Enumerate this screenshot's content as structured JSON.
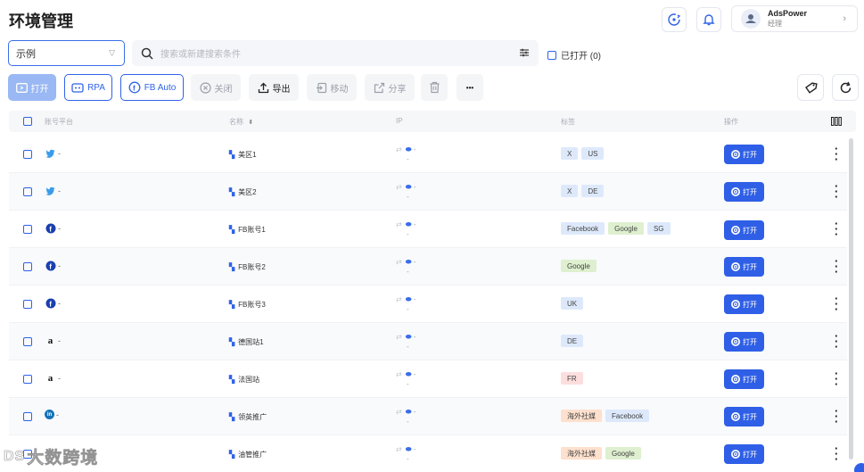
{
  "header": {
    "title": "环境管理",
    "sync_icon": "sync-icon",
    "bell_icon": "bell-icon",
    "user": {
      "name": "AdsPower",
      "role": "经理"
    }
  },
  "search": {
    "group_value": "示例",
    "placeholder": "搜索或新建搜索条件",
    "opened_label": "已打开 (0)"
  },
  "toolbar": {
    "open": "打开",
    "rpa": "RPA",
    "fb_auto": "FB Auto",
    "close": "关闭",
    "export": "导出",
    "move": "移动",
    "share": "分享",
    "more": "•••"
  },
  "table": {
    "headers": {
      "platform": "账号平台",
      "name": "名称",
      "ip": "IP",
      "tags": "标签",
      "actions": "操作"
    },
    "open_label": "打开",
    "rows": [
      {
        "platform": "twitter",
        "platform_icon": "twitter-icon",
        "platform_text": "-",
        "name": "美区1",
        "ip_line1": "-",
        "ip_line2": "-",
        "tags": [
          {
            "text": "X",
            "color": "blue"
          },
          {
            "text": "US",
            "color": "blue"
          }
        ]
      },
      {
        "platform": "twitter",
        "platform_icon": "twitter-icon",
        "platform_text": "-",
        "name": "美区2",
        "ip_line1": "-",
        "ip_line2": "-",
        "tags": [
          {
            "text": "X",
            "color": "blue"
          },
          {
            "text": "DE",
            "color": "blue"
          }
        ]
      },
      {
        "platform": "facebook",
        "platform_icon": "facebook-icon",
        "platform_text": "-",
        "name": "FB账号1",
        "ip_line1": "-",
        "ip_line2": "-",
        "tags": [
          {
            "text": "Facebook",
            "color": "blue"
          },
          {
            "text": "Google",
            "color": "green"
          },
          {
            "text": "SG",
            "color": "blue"
          }
        ]
      },
      {
        "platform": "facebook",
        "platform_icon": "facebook-icon",
        "platform_text": "-",
        "name": "FB账号2",
        "ip_line1": "-",
        "ip_line2": "-",
        "tags": [
          {
            "text": "Google",
            "color": "green"
          }
        ]
      },
      {
        "platform": "facebook",
        "platform_icon": "facebook-icon",
        "platform_text": "-",
        "name": "FB账号3",
        "ip_line1": "-",
        "ip_line2": "-",
        "tags": [
          {
            "text": "UK",
            "color": "blue"
          }
        ]
      },
      {
        "platform": "amazon",
        "platform_icon": "amazon-icon",
        "platform_text": "-",
        "name": "德国站1",
        "ip_line1": "-",
        "ip_line2": "-",
        "tags": [
          {
            "text": "DE",
            "color": "blue"
          }
        ]
      },
      {
        "platform": "amazon",
        "platform_icon": "amazon-icon",
        "platform_text": "-",
        "name": "法国站",
        "ip_line1": "-",
        "ip_line2": "-",
        "tags": [
          {
            "text": "FR",
            "color": "pink"
          }
        ]
      },
      {
        "platform": "linkedin",
        "platform_icon": "linkedin-icon",
        "platform_text": "-",
        "name": "领英推广",
        "ip_line1": "-",
        "ip_line2": "-",
        "tags": [
          {
            "text": "海外社媒",
            "color": "orange"
          },
          {
            "text": "Facebook",
            "color": "blue"
          }
        ]
      },
      {
        "platform": "other",
        "platform_icon": "platform-icon",
        "platform_text": "",
        "name": "油管推广",
        "ip_line1": "-",
        "ip_line2": "-",
        "tags": [
          {
            "text": "海外社媒",
            "color": "orange"
          },
          {
            "text": "Google",
            "color": "green"
          }
        ]
      }
    ]
  },
  "watermark": {
    "text": "大数跨境",
    "logo": "DS"
  },
  "colors": {
    "accent": "#2f5fe6",
    "tag_blue": "#dde9fb",
    "tag_green": "#def0cf",
    "tag_orange": "#fde0cd",
    "tag_pink": "#fddede"
  }
}
